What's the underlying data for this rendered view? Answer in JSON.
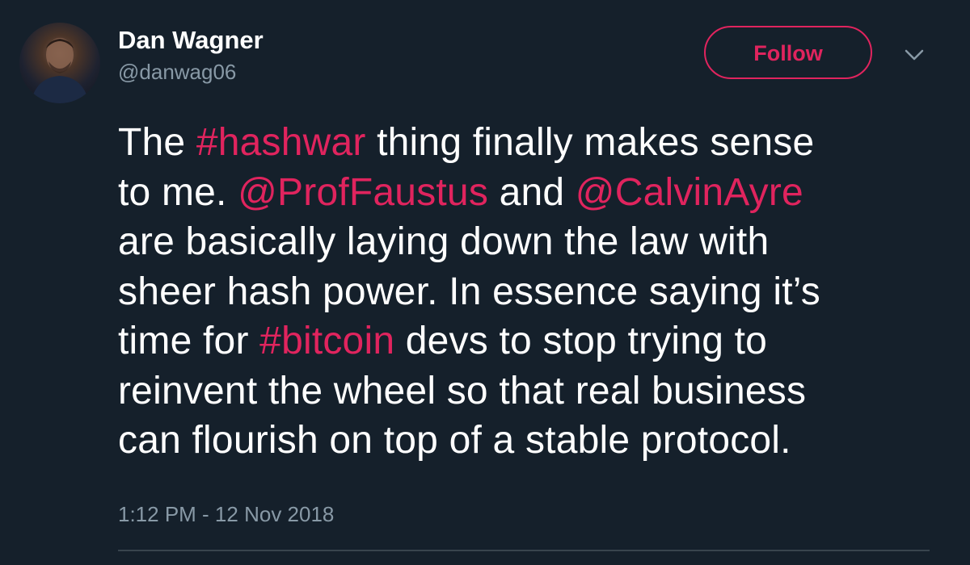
{
  "user": {
    "display_name": "Dan Wagner",
    "handle": "@danwag06"
  },
  "follow_button": {
    "label": "Follow"
  },
  "menu": {
    "icon": "chevron-down-icon"
  },
  "tweet": {
    "line1": {
      "t1": "The ",
      "hashtag1": "#hashwar",
      "t2": " thing finally makes sense"
    },
    "line2": {
      "t1": "to me. ",
      "mention1": "@ProfFaustus",
      "t2": " and ",
      "mention2": "@CalvinAyre"
    },
    "line3": "are basically laying down the law with",
    "line4": "sheer hash power. In essence saying it’s",
    "line5": {
      "t1": "time for ",
      "hashtag2": "#bitcoin",
      "t2": " devs to stop trying to"
    },
    "line6": "reinvent the wheel so that real business",
    "line7": "can flourish on top of a stable protocol."
  },
  "timestamp": "1:12 PM - 12 Nov 2018",
  "colors": {
    "background": "#15202b",
    "accent": "#e0245e",
    "secondary_text": "#8899a6",
    "divider": "#38444d"
  }
}
